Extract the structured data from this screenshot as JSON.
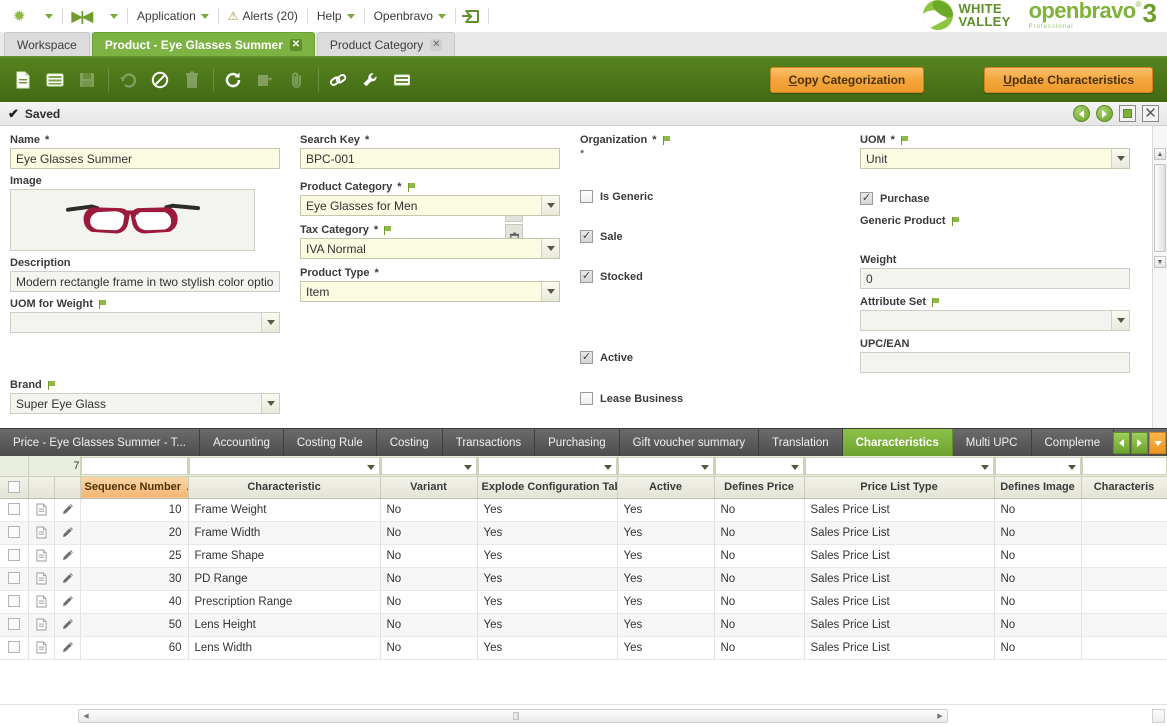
{
  "menubar": {
    "items": [
      {
        "icon": "star-icon",
        "label": ""
      },
      {
        "icon": "fast-forward-icon",
        "label": ""
      },
      {
        "icon": "",
        "label": "Application"
      },
      {
        "icon": "alert-icon",
        "label": "Alerts (20)"
      },
      {
        "icon": "",
        "label": "Help"
      },
      {
        "icon": "",
        "label": "Openbravo"
      },
      {
        "icon": "logout-icon",
        "label": ""
      }
    ],
    "application_label": "Application",
    "alerts_label": "Alerts (20)",
    "help_label": "Help",
    "openbravo_label": "Openbravo"
  },
  "branding": {
    "white_valley_line1": "WHITE",
    "white_valley_line2": "VALLEY",
    "openbravo_word": "openbravo",
    "openbravo_reg": "®",
    "openbravo_version": "3",
    "openbravo_edition": "Professional"
  },
  "window_tabs": [
    {
      "label": "Workspace",
      "active": false,
      "closable": false
    },
    {
      "label": "Product - Eye Glasses Summer",
      "active": true,
      "closable": true
    },
    {
      "label": "Product Category",
      "active": false,
      "closable": true
    }
  ],
  "toolbar": {
    "icons": [
      {
        "name": "new-record-icon",
        "enabled": true
      },
      {
        "name": "grid-view-icon",
        "enabled": true
      },
      {
        "name": "save-icon",
        "enabled": false
      },
      {
        "name": "undo-icon",
        "enabled": false
      },
      {
        "name": "cancel-icon",
        "enabled": true
      },
      {
        "name": "delete-icon",
        "enabled": false
      },
      {
        "name": "refresh-icon",
        "enabled": true
      },
      {
        "name": "export-icon",
        "enabled": false
      },
      {
        "name": "attachment-icon",
        "enabled": false
      },
      {
        "name": "link-icon",
        "enabled": true
      },
      {
        "name": "tools-icon",
        "enabled": true
      },
      {
        "name": "list-icon",
        "enabled": true
      }
    ],
    "copy_categorization_accel": "C",
    "copy_categorization_rest": "opy Categorization",
    "update_characteristics_accel": "U",
    "update_characteristics_rest": "pdate Characteristics"
  },
  "statusbar": {
    "saved_label": "Saved",
    "check_glyph": "✔"
  },
  "form": {
    "name": {
      "label": "Name",
      "required": "*",
      "value": "Eye Glasses Summer"
    },
    "image": {
      "label": "Image",
      "alt": "eyeglasses-photo"
    },
    "description": {
      "label": "Description",
      "value": "Modern rectangle frame in two stylish color options."
    },
    "uom_for_weight": {
      "label": "UOM for Weight",
      "value": ""
    },
    "brand": {
      "label": "Brand",
      "value": "Super Eye Glass"
    },
    "search_key": {
      "label": "Search Key",
      "required": "*",
      "value": "BPC-001"
    },
    "product_category": {
      "label": "Product Category",
      "required": "*",
      "value": "Eye Glasses for Men"
    },
    "tax_category": {
      "label": "Tax Category",
      "required": "*",
      "value": "IVA Normal"
    },
    "product_type": {
      "label": "Product Type",
      "required": "*",
      "value": "Item"
    },
    "organization": {
      "label": "Organization",
      "required": "*",
      "value": "*"
    },
    "is_generic": {
      "label": "Is Generic",
      "checked": false
    },
    "sale": {
      "label": "Sale",
      "checked": true
    },
    "stocked": {
      "label": "Stocked",
      "checked": true
    },
    "active": {
      "label": "Active",
      "checked": true
    },
    "lease_business": {
      "label": "Lease Business",
      "checked": false
    },
    "uom": {
      "label": "UOM",
      "required": "*",
      "value": "Unit"
    },
    "purchase": {
      "label": "Purchase",
      "checked": true
    },
    "generic_product": {
      "label": "Generic Product",
      "value": ""
    },
    "weight": {
      "label": "Weight",
      "value": "0"
    },
    "attribute_set": {
      "label": "Attribute Set",
      "value": ""
    },
    "upc_ean": {
      "label": "UPC/EAN",
      "value": ""
    }
  },
  "sub_tabs": [
    {
      "label": "Price - Eye Glasses Summer - T...",
      "active": false
    },
    {
      "label": "Accounting",
      "active": false
    },
    {
      "label": "Costing Rule",
      "active": false
    },
    {
      "label": "Costing",
      "active": false
    },
    {
      "label": "Transactions",
      "active": false
    },
    {
      "label": "Purchasing",
      "active": false
    },
    {
      "label": "Gift voucher summary",
      "active": false
    },
    {
      "label": "Translation",
      "active": false
    },
    {
      "label": "Characteristics",
      "active": true
    },
    {
      "label": "Multi UPC",
      "active": false
    },
    {
      "label": "Compleme",
      "active": false
    }
  ],
  "grid": {
    "record_count": "7",
    "sort_column": "Sequence Number",
    "sort_direction": "▲",
    "columns": [
      {
        "label": "Sequence Number",
        "align": "num",
        "filter": "text",
        "sorted": true
      },
      {
        "label": "Characteristic",
        "align": "text",
        "filter": "text",
        "sorted": false
      },
      {
        "label": "Variant",
        "align": "text",
        "filter": "dropdown",
        "sorted": false
      },
      {
        "label": "Explode Configuration Tab",
        "align": "text",
        "filter": "dropdown",
        "sorted": false
      },
      {
        "label": "Active",
        "align": "text",
        "filter": "dropdown",
        "sorted": false
      },
      {
        "label": "Defines Price",
        "align": "text",
        "filter": "dropdown",
        "sorted": false
      },
      {
        "label": "Price List Type",
        "align": "text",
        "filter": "dropdown",
        "sorted": false
      },
      {
        "label": "Defines Image",
        "align": "text",
        "filter": "dropdown",
        "sorted": false
      },
      {
        "label": "Characteris",
        "align": "text",
        "filter": "text",
        "sorted": false
      }
    ],
    "rows": [
      {
        "seq": "10",
        "characteristic": "Frame Weight",
        "variant": "No",
        "explode": "Yes",
        "active": "Yes",
        "defines_price": "No",
        "price_list_type": "Sales Price List",
        "defines_image": "No",
        "characteris": ""
      },
      {
        "seq": "20",
        "characteristic": "Frame Width",
        "variant": "No",
        "explode": "Yes",
        "active": "Yes",
        "defines_price": "No",
        "price_list_type": "Sales Price List",
        "defines_image": "No",
        "characteris": ""
      },
      {
        "seq": "25",
        "characteristic": "Frame Shape",
        "variant": "No",
        "explode": "Yes",
        "active": "Yes",
        "defines_price": "No",
        "price_list_type": "Sales Price List",
        "defines_image": "No",
        "characteris": ""
      },
      {
        "seq": "30",
        "characteristic": "PD Range",
        "variant": "No",
        "explode": "Yes",
        "active": "Yes",
        "defines_price": "No",
        "price_list_type": "Sales Price List",
        "defines_image": "No",
        "characteris": ""
      },
      {
        "seq": "40",
        "characteristic": "Prescription Range",
        "variant": "No",
        "explode": "Yes",
        "active": "Yes",
        "defines_price": "No",
        "price_list_type": "Sales Price List",
        "defines_image": "No",
        "characteris": ""
      },
      {
        "seq": "50",
        "characteristic": "Lens Height",
        "variant": "No",
        "explode": "Yes",
        "active": "Yes",
        "defines_price": "No",
        "price_list_type": "Sales Price List",
        "defines_image": "No",
        "characteris": ""
      },
      {
        "seq": "60",
        "characteristic": "Lens Width",
        "variant": "No",
        "explode": "Yes",
        "active": "Yes",
        "defines_price": "No",
        "price_list_type": "Sales Price List",
        "defines_image": "No",
        "characteris": ""
      }
    ]
  },
  "colors": {
    "brand_green": "#7cb342",
    "toolbar_green": "#4b7519",
    "accent_orange": "#f3a63e",
    "required_field_bg": "#fbfbe2",
    "subtab_dark": "#5a5a5a"
  }
}
